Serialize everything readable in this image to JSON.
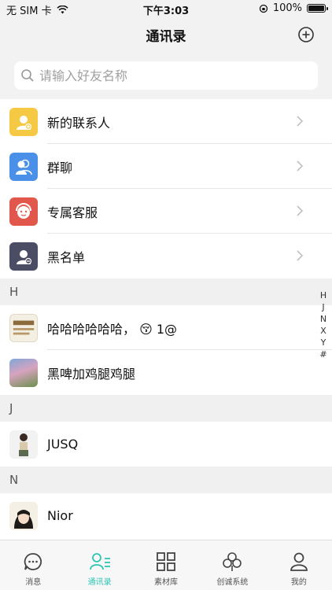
{
  "status": {
    "carrier": "无 SIM 卡",
    "time": "下午3:03",
    "battery": "100%"
  },
  "nav": {
    "title": "通讯录"
  },
  "search": {
    "placeholder": "请输入好友名称"
  },
  "functions": [
    {
      "label": "新的联系人",
      "color": "#f6c944",
      "icon": "new-contact-icon"
    },
    {
      "label": "群聊",
      "color": "#4a8fe8",
      "icon": "group-chat-icon"
    },
    {
      "label": "专属客服",
      "color": "#e2574c",
      "icon": "customer-service-icon"
    },
    {
      "label": "黑名单",
      "color": "#4a4d63",
      "icon": "blacklist-icon"
    }
  ],
  "sections": [
    {
      "letter": "H",
      "contacts": [
        {
          "name": "哈哈哈哈哈哈， 😚 1@"
        },
        {
          "name": "黑啤加鸡腿鸡腿"
        }
      ]
    },
    {
      "letter": "J",
      "contacts": [
        {
          "name": "JUSQ"
        }
      ]
    },
    {
      "letter": "N",
      "contacts": [
        {
          "name": "Nior"
        }
      ]
    }
  ],
  "index": [
    "H",
    "J",
    "N",
    "X",
    "Y",
    "#"
  ],
  "tabs": [
    {
      "label": "消息",
      "icon": "message-icon",
      "active": false
    },
    {
      "label": "通讯录",
      "icon": "contacts-icon",
      "active": true
    },
    {
      "label": "素材库",
      "icon": "library-icon",
      "active": false
    },
    {
      "label": "创诚系统",
      "icon": "system-icon",
      "active": false
    },
    {
      "label": "我的",
      "icon": "profile-icon",
      "active": false
    }
  ],
  "colors": {
    "accent": "#2ec5b6",
    "background": "#f2f2f2"
  }
}
